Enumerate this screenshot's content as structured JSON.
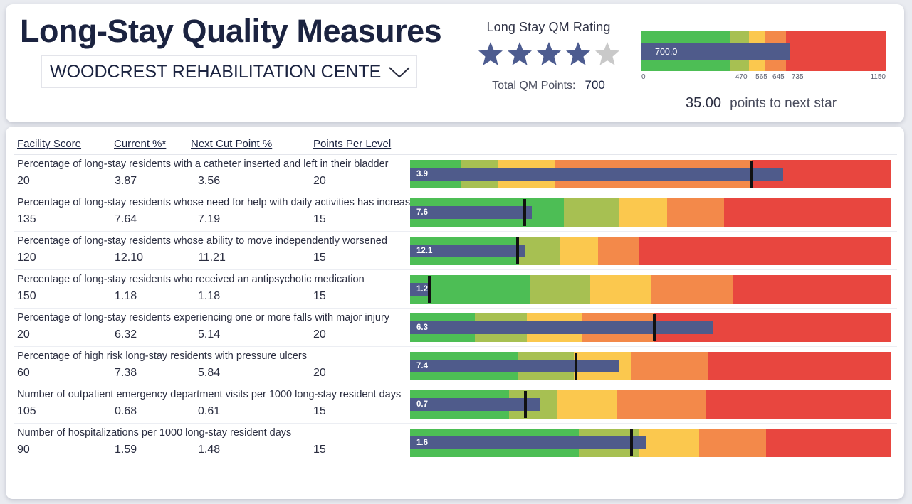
{
  "header": {
    "title": "Long-Stay Quality Measures",
    "facility_select": {
      "value": "WOODCREST REHABILITATION CENTER",
      "icon": "chevron-down-icon"
    },
    "rating": {
      "label": "Long Stay QM Rating",
      "stars_filled": 4,
      "stars_total": 5,
      "filled_color": "#4d5c90",
      "empty_color": "#c9c9c9",
      "total_points_label": "Total QM Points:",
      "total_points_value": "700"
    },
    "next_star": {
      "value": "35.00",
      "label": "points to next star"
    }
  },
  "table": {
    "headers": [
      "Facility Score",
      "Current %*",
      "Next Cut Point %",
      "Points Per Level"
    ],
    "rows": [
      {
        "measure": "Percentage of long-stay residents with a catheter inserted and left in their bladder",
        "facility_score": "20",
        "current_pct": "3.87",
        "next_cut_point": "3.56",
        "points_per_level": "20",
        "bullet_label": "3.9"
      },
      {
        "measure": "Percentage of long-stay residents whose need for help with daily activities has increased",
        "facility_score": "135",
        "current_pct": "7.64",
        "next_cut_point": "7.19",
        "points_per_level": "15",
        "bullet_label": "7.6"
      },
      {
        "measure": "Percentage of long-stay residents whose ability to move independently worsened",
        "facility_score": "120",
        "current_pct": "12.10",
        "next_cut_point": "11.21",
        "points_per_level": "15",
        "bullet_label": "12.1"
      },
      {
        "measure": "Percentage of long-stay residents who received an antipsychotic medication",
        "facility_score": "150",
        "current_pct": "1.18",
        "next_cut_point": "1.18",
        "points_per_level": "15",
        "bullet_label": "1.2"
      },
      {
        "measure": "Percentage of long-stay residents experiencing one or more falls with major injury",
        "facility_score": "20",
        "current_pct": "6.32",
        "next_cut_point": "5.14",
        "points_per_level": "20",
        "bullet_label": "6.3"
      },
      {
        "measure": "Percentage of high risk long-stay residents with pressure ulcers",
        "facility_score": "60",
        "current_pct": "7.38",
        "next_cut_point": "5.84",
        "points_per_level": "20",
        "bullet_label": "7.4"
      },
      {
        "measure": "Number of outpatient emergency department visits per 1000 long-stay resident days",
        "facility_score": "105",
        "current_pct": "0.68",
        "next_cut_point": "0.61",
        "points_per_level": "15",
        "bullet_label": "0.7"
      },
      {
        "measure": "Number of hospitalizations per 1000 long-stay resident days",
        "facility_score": "90",
        "current_pct": "1.59",
        "next_cut_point": "1.48",
        "points_per_level": "15",
        "bullet_label": "1.6"
      }
    ]
  },
  "palette": {
    "green": "#4dbe55",
    "yellow_green": "#a7c052",
    "yellow": "#fbc84e",
    "orange": "#f3894a",
    "red": "#e8463f",
    "value_bar": "#4f5b8b",
    "target": "#111111",
    "page_bg": "#e9ebf0",
    "card_bg": "#ffffff",
    "text": "#1b2340"
  },
  "chart_data": [
    {
      "type": "bar",
      "id": "qm-points-bullet",
      "title": "Long Stay QM Rating",
      "orientation": "horizontal",
      "value": 700.0,
      "value_label": "700.0",
      "xlim": [
        0,
        1150
      ],
      "tick_labels": [
        "0",
        "470",
        "565",
        "645",
        "735",
        "1150"
      ],
      "ticks": [
        0,
        470,
        565,
        645,
        735,
        1150
      ],
      "bands": [
        {
          "from": 0,
          "to": 470,
          "color": "#e8463f"
        },
        {
          "from": 470,
          "to": 565,
          "color": "#f3894a"
        },
        {
          "from": 565,
          "to": 645,
          "color": "#fbc84e"
        },
        {
          "from": 645,
          "to": 735,
          "color": "#a7c052"
        },
        {
          "from": 735,
          "to": 1150,
          "color": "#4dbe55"
        }
      ],
      "annotation": "35.00 points to next star"
    },
    {
      "type": "bar",
      "id": "measure-bullets",
      "orientation": "horizontal",
      "note": "Per-measure bullet charts; band boundaries and value/target positions expressed as percent of track width (lower is better — green at left except row 1).",
      "series": [
        {
          "name": "Percentage of long-stay residents with a catheter inserted and left in their bladder",
          "value": 3.87,
          "value_label": "3.9",
          "target": 3.56,
          "value_pct": 77.5,
          "target_pct": 71.0,
          "bands_pct": [
            {
              "to": 10.5,
              "color": "#4dbe55"
            },
            {
              "to": 18.2,
              "color": "#a7c052"
            },
            {
              "to": 30.0,
              "color": "#fbc84e"
            },
            {
              "to": 71.0,
              "color": "#f3894a"
            },
            {
              "to": 100,
              "color": "#e8463f"
            }
          ]
        },
        {
          "name": "Percentage of long-stay residents whose need for help with daily activities has increased",
          "value": 7.64,
          "value_label": "7.6",
          "target": 7.19,
          "value_pct": 25.3,
          "target_pct": 23.8,
          "bands_pct": [
            {
              "to": 32.0,
              "color": "#4dbe55"
            },
            {
              "to": 43.3,
              "color": "#a7c052"
            },
            {
              "to": 53.4,
              "color": "#fbc84e"
            },
            {
              "to": 65.3,
              "color": "#f3894a"
            },
            {
              "to": 100,
              "color": "#e8463f"
            }
          ]
        },
        {
          "name": "Percentage of long-stay residents whose ability to move independently worsened",
          "value": 12.1,
          "value_label": "12.1",
          "target": 11.21,
          "value_pct": 23.8,
          "target_pct": 22.3,
          "bands_pct": [
            {
              "to": 22.6,
              "color": "#4dbe55"
            },
            {
              "to": 31.1,
              "color": "#a7c052"
            },
            {
              "to": 39.0,
              "color": "#fbc84e"
            },
            {
              "to": 47.6,
              "color": "#f3894a"
            },
            {
              "to": 100,
              "color": "#e8463f"
            }
          ]
        },
        {
          "name": "Percentage of long-stay residents who received an antipsychotic medication",
          "value": 1.18,
          "value_label": "1.2",
          "target": 1.18,
          "value_pct": 4.5,
          "target_pct": 4.0,
          "bands_pct": [
            {
              "to": 24.8,
              "color": "#4dbe55"
            },
            {
              "to": 37.4,
              "color": "#a7c052"
            },
            {
              "to": 50.0,
              "color": "#fbc84e"
            },
            {
              "to": 67.0,
              "color": "#f3894a"
            },
            {
              "to": 100,
              "color": "#e8463f"
            }
          ]
        },
        {
          "name": "Percentage of long-stay residents experiencing one or more falls with major injury",
          "value": 6.32,
          "value_label": "6.3",
          "target": 5.14,
          "value_pct": 63.0,
          "target_pct": 50.8,
          "bands_pct": [
            {
              "to": 13.5,
              "color": "#4dbe55"
            },
            {
              "to": 24.2,
              "color": "#a7c052"
            },
            {
              "to": 35.6,
              "color": "#fbc84e"
            },
            {
              "to": 50.8,
              "color": "#f3894a"
            },
            {
              "to": 100,
              "color": "#e8463f"
            }
          ]
        },
        {
          "name": "Percentage of high risk long-stay residents with pressure ulcers",
          "value": 7.38,
          "value_label": "7.4",
          "target": 5.84,
          "value_pct": 43.5,
          "target_pct": 34.5,
          "bands_pct": [
            {
              "to": 22.5,
              "color": "#4dbe55"
            },
            {
              "to": 34.0,
              "color": "#a7c052"
            },
            {
              "to": 46.0,
              "color": "#fbc84e"
            },
            {
              "to": 62.0,
              "color": "#f3894a"
            },
            {
              "to": 100,
              "color": "#e8463f"
            }
          ]
        },
        {
          "name": "Number of outpatient emergency department visits per 1000 long-stay resident days",
          "value": 0.68,
          "value_label": "0.7",
          "target": 0.61,
          "value_pct": 27.0,
          "target_pct": 24.0,
          "bands_pct": [
            {
              "to": 20.5,
              "color": "#4dbe55"
            },
            {
              "to": 30.5,
              "color": "#a7c052"
            },
            {
              "to": 43.0,
              "color": "#fbc84e"
            },
            {
              "to": 61.5,
              "color": "#f3894a"
            },
            {
              "to": 100,
              "color": "#e8463f"
            }
          ]
        },
        {
          "name": "Number of hospitalizations per 1000 long-stay resident days",
          "value": 1.59,
          "value_label": "1.6",
          "target": 1.48,
          "value_pct": 49.0,
          "target_pct": 46.0,
          "bands_pct": [
            {
              "to": 35.0,
              "color": "#4dbe55"
            },
            {
              "to": 47.5,
              "color": "#a7c052"
            },
            {
              "to": 60.0,
              "color": "#fbc84e"
            },
            {
              "to": 74.0,
              "color": "#f3894a"
            },
            {
              "to": 100,
              "color": "#e8463f"
            }
          ]
        }
      ]
    }
  ]
}
